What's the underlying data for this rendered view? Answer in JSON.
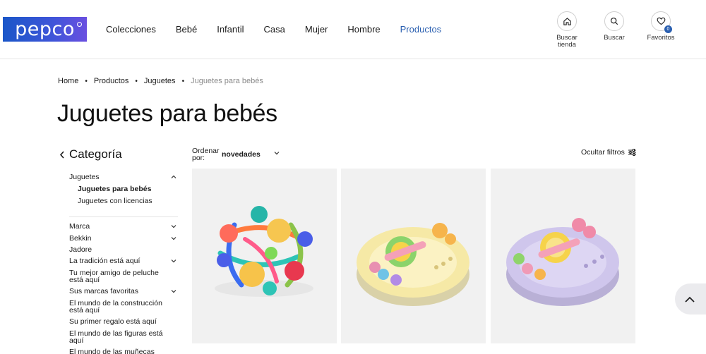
{
  "brand": {
    "logo_text": "pepco"
  },
  "nav": {
    "items": [
      {
        "label": "Colecciones"
      },
      {
        "label": "Bebé"
      },
      {
        "label": "Infantil"
      },
      {
        "label": "Casa"
      },
      {
        "label": "Mujer"
      },
      {
        "label": "Hombre"
      },
      {
        "label": "Productos",
        "active": true
      }
    ]
  },
  "header_actions": {
    "store": {
      "label": "Buscar tienda",
      "icon": "home-icon"
    },
    "search": {
      "label": "Buscar",
      "icon": "search-icon"
    },
    "favorites": {
      "label": "Favoritos",
      "icon": "heart-icon",
      "count": "0"
    }
  },
  "breadcrumb": [
    "Home",
    "Productos",
    "Juguetes",
    "Juguetes para bebés"
  ],
  "page_title": "Juguetes para bebés",
  "sidebar": {
    "title": "Categoría",
    "category": {
      "label": "Juguetes",
      "subitems": [
        "Juguetes para bebés",
        "Juguetes con licencias"
      ],
      "active_sub": "Juguetes para bebés"
    },
    "filters": [
      {
        "label": "Marca",
        "expandable": true
      },
      {
        "label": "Bekkin",
        "expandable": true
      },
      {
        "label": "Jadore",
        "expandable": false
      },
      {
        "label": "La tradición está aquí",
        "expandable": true
      },
      {
        "label": "Tu mejor amigo de peluche está aquí",
        "expandable": false
      },
      {
        "label": "Sus marcas favoritas",
        "expandable": true
      },
      {
        "label": "El mundo de la construcción está aquí",
        "expandable": false
      },
      {
        "label": "Su primer regalo está aquí",
        "expandable": false
      },
      {
        "label": "El mundo de las figuras está aquí",
        "expandable": false
      },
      {
        "label": "El mundo de las muñecas",
        "expandable": false
      }
    ]
  },
  "toolbar": {
    "sort_label": "Ordenar por:",
    "sort_value": "novedades",
    "hide_filters_label": "Ocultar filtros"
  },
  "products": [
    {
      "image": "colorful-rattle-ball-toy"
    },
    {
      "image": "yellow-sensory-spinner-toy"
    },
    {
      "image": "purple-sensory-spinner-toy"
    }
  ],
  "colors": {
    "accent": "#2a5fb0",
    "brand": "#1a56c8",
    "card_bg": "#f1f1f1"
  }
}
